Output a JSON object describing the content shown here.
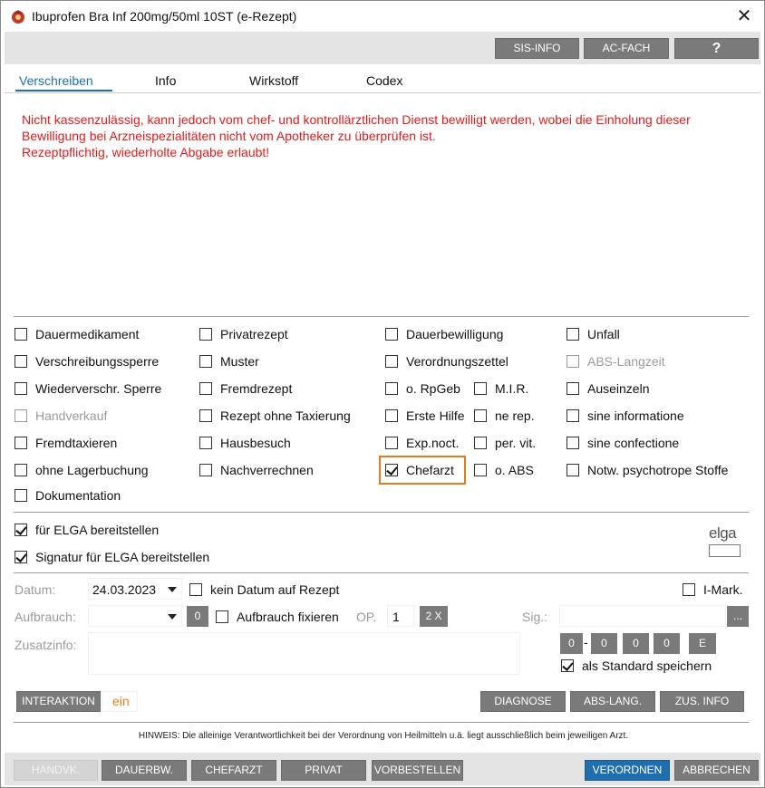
{
  "window": {
    "title": "Ibuprofen Bra Inf 200mg/50ml 10ST (e-Rezept)",
    "close_symbol": "✕"
  },
  "toolbar": {
    "sis_info": "SIS-INFO",
    "ac_fach": "AC-FACH",
    "help": "?"
  },
  "tabs": [
    {
      "label": "Verschreiben",
      "active": true
    },
    {
      "label": "Info",
      "active": false
    },
    {
      "label": "Wirkstoff",
      "active": false
    },
    {
      "label": "Codex",
      "active": false
    }
  ],
  "notice": {
    "lines": [
      "Nicht kassenzulässig, kann jedoch vom chef- und kontrollärztlichen Dienst bewilligt werden, wobei die Einholung dieser",
      "Bewilligung bei Arzneispezialitäten nicht vom Apotheker zu überprüfen ist.",
      "Rezeptpflichtig, wiederholte Abgabe erlaubt!"
    ],
    "color": "#e01b1b"
  },
  "checkboxes": {
    "dauermedikament": {
      "label": "Dauermedikament",
      "checked": false
    },
    "verschreibungssperre": {
      "label": "Verschreibungssperre",
      "checked": false
    },
    "wiederverschr_sperre": {
      "label": "Wiederverschr. Sperre",
      "checked": false
    },
    "handverkauf": {
      "label": "Handverkauf",
      "checked": false,
      "disabled": true
    },
    "fremdtaxieren": {
      "label": "Fremdtaxieren",
      "checked": false
    },
    "ohne_lagerbuchung": {
      "label": "ohne Lagerbuchung",
      "checked": false
    },
    "dokumentation": {
      "label": "Dokumentation",
      "checked": false
    },
    "privatrezept": {
      "label": "Privatrezept",
      "checked": false
    },
    "muster": {
      "label": "Muster",
      "checked": false
    },
    "fremdrezept": {
      "label": "Fremdrezept",
      "checked": false
    },
    "rezept_ohne_taxierung": {
      "label": "Rezept ohne Taxierung",
      "checked": false
    },
    "hausbesuch": {
      "label": "Hausbesuch",
      "checked": false
    },
    "nachverrechnen": {
      "label": "Nachverrechnen",
      "checked": false
    },
    "dauerbewilligung": {
      "label": "Dauerbewilligung",
      "checked": false
    },
    "verordnungszettel": {
      "label": "Verordnungszettel",
      "checked": false
    },
    "o_rpgeb": {
      "label": "o. RpGeb",
      "checked": false
    },
    "erste_hilfe": {
      "label": "Erste Hilfe",
      "checked": false
    },
    "exp_noct": {
      "label": "Exp.noct.",
      "checked": false
    },
    "chefarzt": {
      "label": "Chefarzt",
      "checked": true
    },
    "mir": {
      "label": "M.I.R.",
      "checked": false
    },
    "ne_rep": {
      "label": "ne rep.",
      "checked": false
    },
    "per_vit": {
      "label": "per. vit.",
      "checked": false
    },
    "o_abs": {
      "label": "o. ABS",
      "checked": false
    },
    "unfall": {
      "label": "Unfall",
      "checked": false
    },
    "abs_langzeit": {
      "label": "ABS-Langzeit",
      "checked": false,
      "disabled": true
    },
    "auseinzeln": {
      "label": "Auseinzeln",
      "checked": false
    },
    "sine_informatione": {
      "label": "sine informatione",
      "checked": false
    },
    "sine_confectione": {
      "label": "sine confectione",
      "checked": false
    },
    "notw_psychotrope": {
      "label": "Notw. psychotrope Stoffe",
      "checked": false
    },
    "fuer_elga": {
      "label": "für ELGA bereitstellen",
      "checked": true
    },
    "signatur_elga": {
      "label": "Signatur für ELGA bereitstellen",
      "checked": true
    },
    "kein_datum": {
      "label": "kein Datum auf Rezept",
      "checked": false
    },
    "aufbrauch_fixieren": {
      "label": "Aufbrauch fixieren",
      "checked": false
    },
    "i_mark": {
      "label": "I-Mark.",
      "checked": false
    },
    "als_standard": {
      "label": "als Standard speichern",
      "checked": true
    }
  },
  "elga_logo_text": "elga",
  "form": {
    "datum_label": "Datum:",
    "datum_value": "24.03.2023",
    "aufbrauch_label": "Aufbrauch:",
    "aufbrauch_value": "",
    "aufbrauch_count": "0",
    "op_label": "OP.",
    "op_value": "1",
    "op_button": "2 X",
    "sig_label": "Sig.:",
    "sig_value": "",
    "sig_button": "...",
    "zusatzinfo_label": "Zusatzinfo:",
    "zusatzinfo_value": "",
    "dosage": [
      "0",
      "0",
      "0",
      "0"
    ],
    "dosage_sep": "-",
    "dosage_e": "E"
  },
  "actions": {
    "interaktion": "INTERAKTION",
    "interaktion_status": "ein",
    "interaktion_status_color": "#e07b20",
    "diagnose": "DIAGNOSE",
    "abs_lang": "ABS-LANG.",
    "zus_info": "ZUS. INFO"
  },
  "hinweis": "HINWEIS: Die alleinige Verantwortlichkeit bei der Verordnung von Heilmitteln u.ä. liegt ausschließlich beim jeweiligen Arzt.",
  "bottom": {
    "handvk": "HANDVK.",
    "dauerbw": "DAUERBW.",
    "chefarzt": "CHEFARZT",
    "privat": "PRIVAT",
    "vorbestellen": "VORBESTELLEN",
    "verordnen": "VERORDNEN",
    "abbrechen": "ABBRECHEN"
  },
  "colors": {
    "accent": "#1f6fae",
    "button_gray": "#7a7a7a",
    "highlight": "#e07b20",
    "notice": "#e01b1b"
  }
}
